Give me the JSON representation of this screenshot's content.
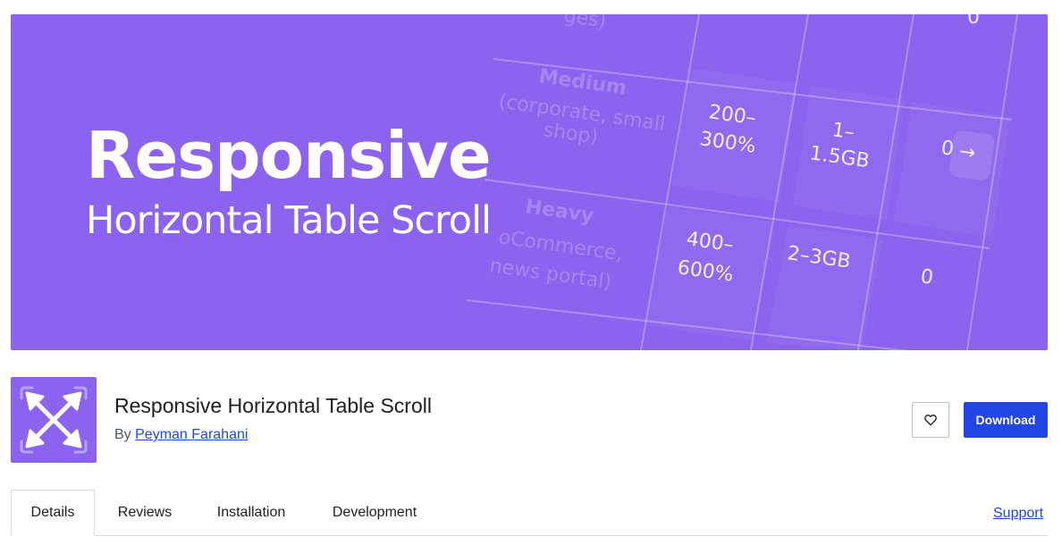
{
  "banner": {
    "title": "Responsive",
    "subtitle": "Horizontal Table Scroll",
    "bg_table": {
      "row_top": "ges)",
      "row_top_value": "0",
      "medium_label_1": "Medium",
      "medium_label_2": "(corporate, small",
      "medium_label_3": "shop)",
      "medium_cpu_1": "200–",
      "medium_cpu_2": "300%",
      "medium_ram_1": "1–",
      "medium_ram_2": "1.5GB",
      "medium_last": "0",
      "heavy_label_1": "Heavy",
      "heavy_label_2": "oCommerce,",
      "heavy_label_3": "news portal)",
      "heavy_cpu_1": "400–",
      "heavy_cpu_2": "600%",
      "heavy_ram": "2–3GB",
      "heavy_last": "0",
      "scroll_arrow": "→"
    }
  },
  "plugin": {
    "title": "Responsive Horizontal Table Scroll",
    "by_label": "By",
    "author": "Peyman Farahani",
    "icon": "expand-arrows-icon"
  },
  "actions": {
    "favorite_icon": "heart-icon",
    "download_label": "Download"
  },
  "tabs": [
    {
      "label": "Details",
      "active": true
    },
    {
      "label": "Reviews",
      "active": false
    },
    {
      "label": "Installation",
      "active": false
    },
    {
      "label": "Development",
      "active": false
    }
  ],
  "support_label": "Support",
  "colors": {
    "banner_bg": "#8b63ee",
    "primary_button": "#2145e6",
    "link": "#2145e6"
  }
}
